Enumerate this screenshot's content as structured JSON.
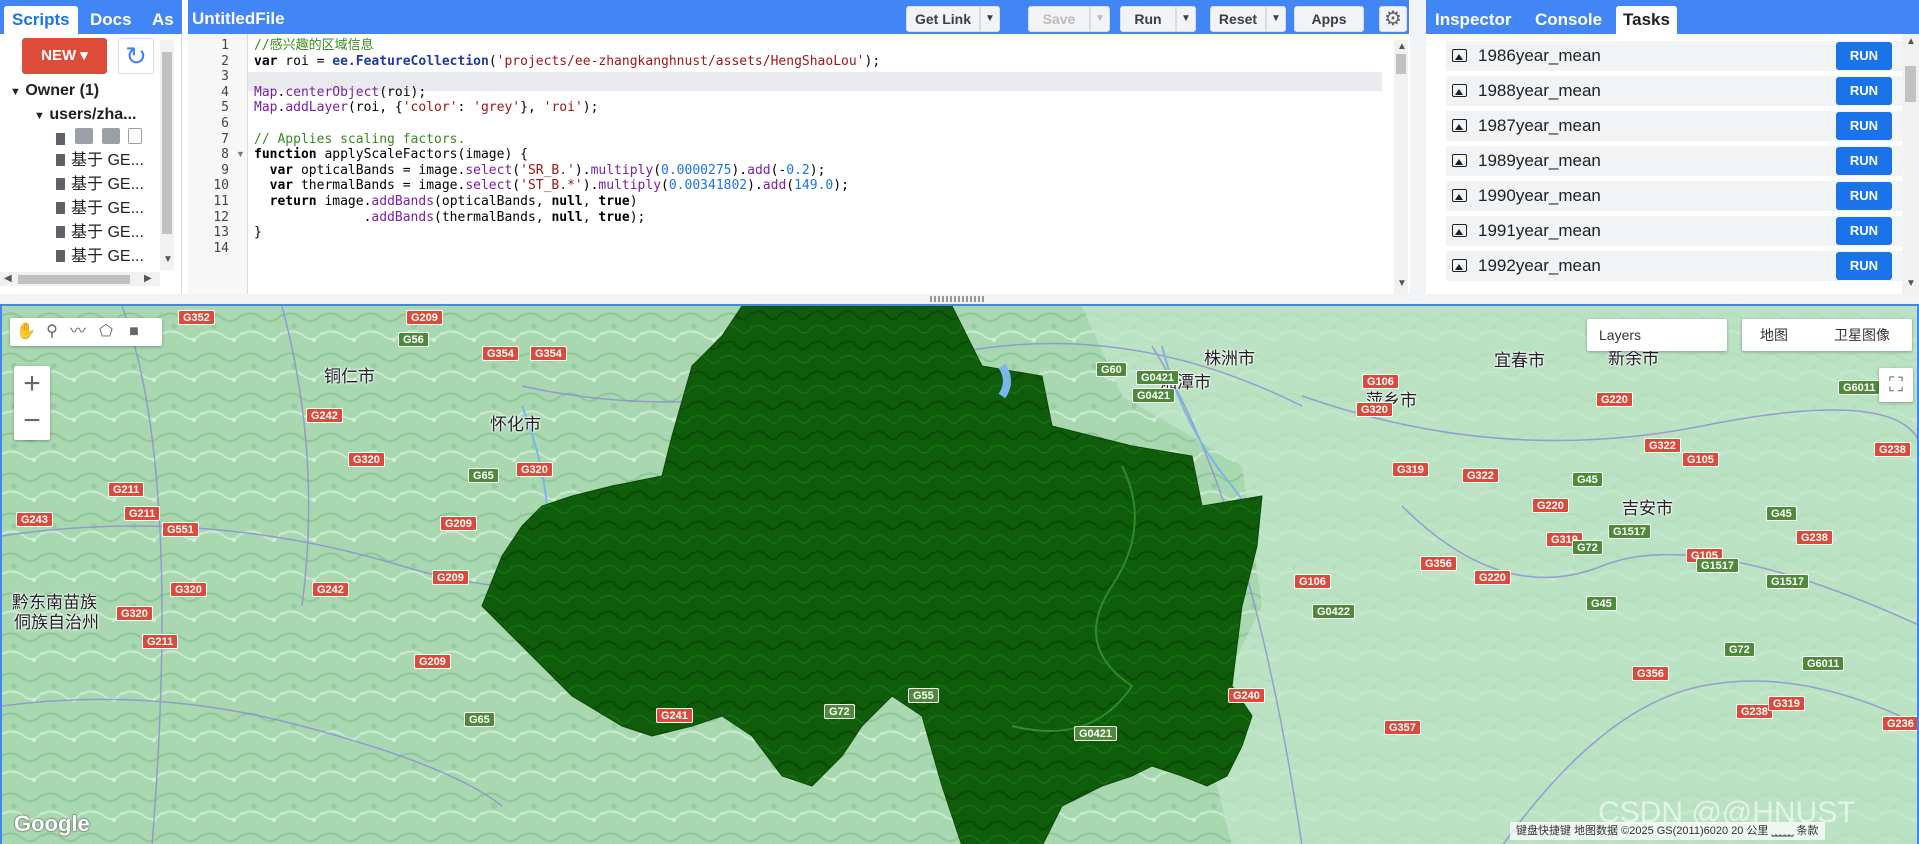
{
  "left_panel": {
    "tabs": [
      {
        "label": "Scripts"
      },
      {
        "label": "Docs"
      },
      {
        "label": "As"
      }
    ],
    "new_button": "NEW ▾",
    "tree": {
      "owner": "Owner (1)",
      "repo": "users/zha...",
      "files": [
        "基于 GE...",
        "基于 GE...",
        "基于 GE...",
        "基于 GE...",
        "基于 GE..."
      ]
    }
  },
  "editor": {
    "file_title": "UntitledFile",
    "buttons": {
      "get_link": "Get Link",
      "save": "Save",
      "run": "Run",
      "reset": "Reset",
      "apps": "Apps"
    },
    "line_numbers": [
      "1",
      "2",
      "3",
      "4",
      "5",
      "6",
      "7",
      "8",
      "9",
      "10",
      "11",
      "12",
      "13",
      "14"
    ],
    "code_lines": [
      "//感兴趣的区域信息",
      "var roi = ee.FeatureCollection('projects/ee-zhangkanghnust/assets/HengShaoLou');",
      "",
      "Map.centerObject(roi);",
      "Map.addLayer(roi, {'color': 'grey'}, 'roi');",
      "",
      "// Applies scaling factors.",
      "function applyScaleFactors(image) {",
      "  var opticalBands = image.select('SR_B.').multiply(0.0000275).add(-0.2);",
      "  var thermalBands = image.select('ST_B.*').multiply(0.00341802).add(149.0);",
      "  return image.addBands(opticalBands, null, true)",
      "              .addBands(thermalBands, null, true);",
      "}"
    ]
  },
  "right_panel": {
    "tabs": [
      {
        "label": "Inspector"
      },
      {
        "label": "Console"
      },
      {
        "label": "Tasks"
      }
    ],
    "tasks": [
      {
        "name": "1986year_mean",
        "action": "RUN"
      },
      {
        "name": "1988year_mean",
        "action": "RUN"
      },
      {
        "name": "1987year_mean",
        "action": "RUN"
      },
      {
        "name": "1989year_mean",
        "action": "RUN"
      },
      {
        "name": "1990year_mean",
        "action": "RUN"
      },
      {
        "name": "1991year_mean",
        "action": "RUN"
      },
      {
        "name": "1992year_mean",
        "action": "RUN"
      }
    ]
  },
  "map": {
    "layers_label": "Layers",
    "map_types": [
      "地图",
      "卫星图像"
    ],
    "attribution": "键盘快捷键   地图数据 ©2025 GS(2011)6020   20 公里 ⎵⎵⎵⎵⎵   条款",
    "google_logo": "Google",
    "watermark": "CSDN @@HNUST",
    "cities": [
      "铜仁市",
      "怀化市",
      "株洲市",
      "湘潭市",
      "宜春市",
      "新余市",
      "萍乡市",
      "吉安市",
      "黔东南苗族",
      "侗族自治州"
    ],
    "road_shields": [
      "G352",
      "G209",
      "G56",
      "G354",
      "G354",
      "G242",
      "G320",
      "G320",
      "G65",
      "G211",
      "G211",
      "G243",
      "G551",
      "G209",
      "G320",
      "G242",
      "G209",
      "G320",
      "G211",
      "G209",
      "G241",
      "G72",
      "G55",
      "G65",
      "G0421",
      "G60",
      "G0421",
      "G106",
      "G320",
      "G319",
      "G322",
      "G322",
      "G45",
      "G105",
      "G238",
      "G220",
      "G319",
      "G72",
      "G356",
      "G220",
      "G106",
      "G0422",
      "G45",
      "G105",
      "G1517",
      "G1517",
      "G238",
      "G72",
      "G356",
      "G240",
      "G357",
      "G0421",
      "G238",
      "G319",
      "G6011",
      "G6011",
      "G236",
      "G220",
      "G1517",
      "G45"
    ],
    "colors": {
      "roi_fill": "#0f5c0a",
      "map_base": "#b2dfb8",
      "accent": "#4285f4",
      "run_button": "#1a73e8",
      "new_button": "#dd4b39"
    }
  }
}
